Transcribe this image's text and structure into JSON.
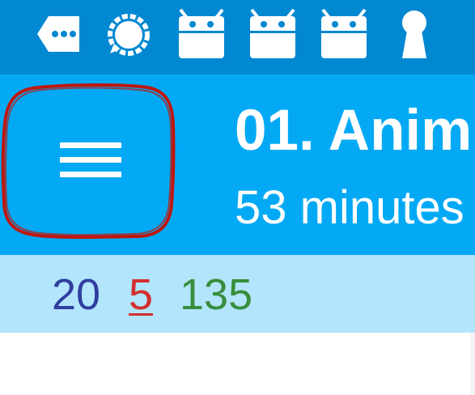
{
  "colors": {
    "status_bar": "#0288d1",
    "app_bar": "#03a9f4",
    "counts_bar": "#b3e5fc",
    "new_count": "#303f9f",
    "learn_count": "#d32f2f",
    "due_count": "#388e3c",
    "annotation": "#c0160c"
  },
  "status_bar": {
    "icons": [
      "notification-dots-icon",
      "signal-messenger-icon",
      "android-robot-icon",
      "android-robot-icon",
      "android-robot-icon",
      "keyhole-icon"
    ]
  },
  "app_bar": {
    "menu_icon": "hamburger-menu-icon",
    "title": "01. Anim",
    "subtitle": "53 minutes"
  },
  "counts": {
    "new": "20",
    "learn": "5",
    "due": "135"
  }
}
